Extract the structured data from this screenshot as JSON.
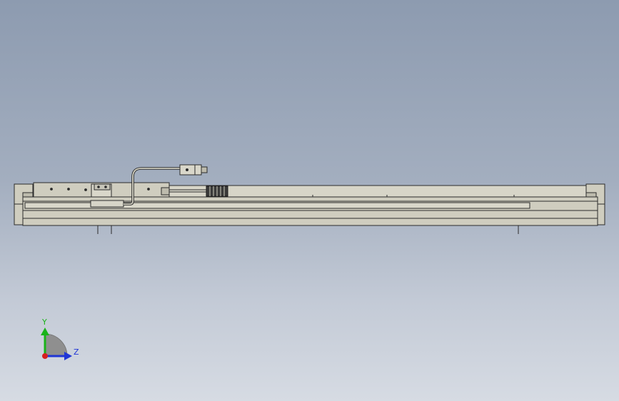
{
  "viewport": {
    "background_top": "#8d9bb0",
    "background_bottom": "#d6dbe3"
  },
  "model": {
    "body_color": "#cfcdbf",
    "edge_color": "#2b2b2b",
    "rail_color": "#d7d5c8",
    "motor_color": "#3a3a3a"
  },
  "triad": {
    "y_label": "Y",
    "z_label": "Z",
    "y_color": "#19b319",
    "z_color": "#1f35d6",
    "x_color": "#d61f1f"
  }
}
